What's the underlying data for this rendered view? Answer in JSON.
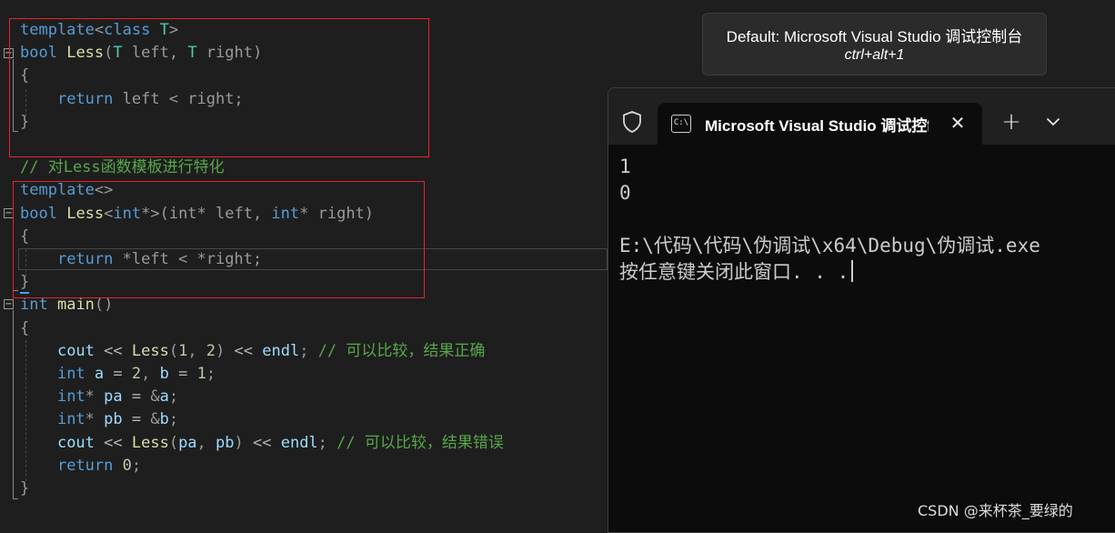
{
  "editor": {
    "code": [
      [
        [
          "kw",
          "template"
        ],
        [
          "pr",
          "<"
        ],
        [
          "kw",
          "class"
        ],
        [
          "tx",
          " "
        ],
        [
          "ty",
          "T"
        ],
        [
          "pr",
          ">"
        ]
      ],
      [
        [
          "kw",
          "bool"
        ],
        [
          "tx",
          " "
        ],
        [
          "fn",
          "Less"
        ],
        [
          "pr",
          "("
        ],
        [
          "ty",
          "T"
        ],
        [
          "pr",
          " left, "
        ],
        [
          "ty",
          "T"
        ],
        [
          "pr",
          " right)"
        ]
      ],
      [
        [
          "pr",
          "{"
        ]
      ],
      [
        [
          "tx",
          "    "
        ],
        [
          "kw",
          "return"
        ],
        [
          "pr",
          " left < right;"
        ]
      ],
      [
        [
          "pr",
          "}"
        ]
      ],
      [],
      [
        [
          "cm",
          "// 对Less函数模板进行特化"
        ]
      ],
      [
        [
          "kw",
          "template"
        ],
        [
          "pr",
          "<>"
        ]
      ],
      [
        [
          "kw",
          "bool"
        ],
        [
          "tx",
          " "
        ],
        [
          "fn",
          "Less"
        ],
        [
          "pr",
          "<"
        ],
        [
          "kw",
          "int"
        ],
        [
          "pr",
          "*>(int* left, "
        ],
        [
          "kw",
          "int"
        ],
        [
          "pr",
          "* right)"
        ]
      ],
      [
        [
          "pr",
          "{"
        ]
      ],
      [
        [
          "tx",
          "    "
        ],
        [
          "kw",
          "return"
        ],
        [
          "pr",
          " *left < *right;"
        ]
      ],
      [
        [
          "pr",
          "}"
        ]
      ],
      [
        [
          "kw",
          "int"
        ],
        [
          "tx",
          " "
        ],
        [
          "fn",
          "main"
        ],
        [
          "pr",
          "()"
        ]
      ],
      [
        [
          "pr",
          "{"
        ]
      ],
      [
        [
          "tx",
          "    "
        ],
        [
          "va",
          "cout"
        ],
        [
          "op",
          " << "
        ],
        [
          "fn",
          "Less"
        ],
        [
          "pr",
          "("
        ],
        [
          "nu",
          "1"
        ],
        [
          "pr",
          ", "
        ],
        [
          "nu",
          "2"
        ],
        [
          "pr",
          ")"
        ],
        [
          "op",
          " << "
        ],
        [
          "va",
          "endl"
        ],
        [
          "pr",
          "; "
        ],
        [
          "cm",
          "// 可以比较，结果正确"
        ]
      ],
      [
        [
          "tx",
          "    "
        ],
        [
          "kw",
          "int"
        ],
        [
          "tx",
          " "
        ],
        [
          "va",
          "a"
        ],
        [
          "op",
          " = "
        ],
        [
          "nu",
          "2"
        ],
        [
          "pr",
          ", "
        ],
        [
          "va",
          "b"
        ],
        [
          "op",
          " = "
        ],
        [
          "nu",
          "1"
        ],
        [
          "pr",
          ";"
        ]
      ],
      [
        [
          "tx",
          "    "
        ],
        [
          "kw",
          "int"
        ],
        [
          "pr",
          "* "
        ],
        [
          "va",
          "pa"
        ],
        [
          "op",
          " = "
        ],
        [
          "pr",
          "&"
        ],
        [
          "va",
          "a"
        ],
        [
          "pr",
          ";"
        ]
      ],
      [
        [
          "tx",
          "    "
        ],
        [
          "kw",
          "int"
        ],
        [
          "pr",
          "* "
        ],
        [
          "va",
          "pb"
        ],
        [
          "op",
          " = "
        ],
        [
          "pr",
          "&"
        ],
        [
          "va",
          "b"
        ],
        [
          "pr",
          ";"
        ]
      ],
      [
        [
          "tx",
          "    "
        ],
        [
          "va",
          "cout"
        ],
        [
          "op",
          " << "
        ],
        [
          "fn",
          "Less"
        ],
        [
          "pr",
          "("
        ],
        [
          "va",
          "pa"
        ],
        [
          "pr",
          ", "
        ],
        [
          "va",
          "pb"
        ],
        [
          "pr",
          ")"
        ],
        [
          "op",
          " << "
        ],
        [
          "va",
          "endl"
        ],
        [
          "pr",
          "; "
        ],
        [
          "cm",
          "// 可以比较，结果错误"
        ]
      ],
      [
        [
          "tx",
          "    "
        ],
        [
          "kw",
          "return"
        ],
        [
          "tx",
          " "
        ],
        [
          "nu",
          "0"
        ],
        [
          "pr",
          ";"
        ]
      ],
      [
        [
          "pr",
          "}"
        ]
      ]
    ]
  },
  "tooltip": {
    "title": "Default: Microsoft Visual Studio 调试控制台",
    "shortcut": "ctrl+alt+1"
  },
  "terminal": {
    "tab_title": "Microsoft Visual Studio 调试控制台",
    "tab_icon_text": "C:\\",
    "close_glyph": "✕",
    "new_tab_glyph": "+",
    "output": [
      "1",
      "0",
      "",
      "E:\\代码\\代码\\伪调试\\x64\\Debug\\伪调试.exe",
      "按任意键关闭此窗口. . ."
    ]
  },
  "watermark": "CSDN @来杯茶_要绿的"
}
